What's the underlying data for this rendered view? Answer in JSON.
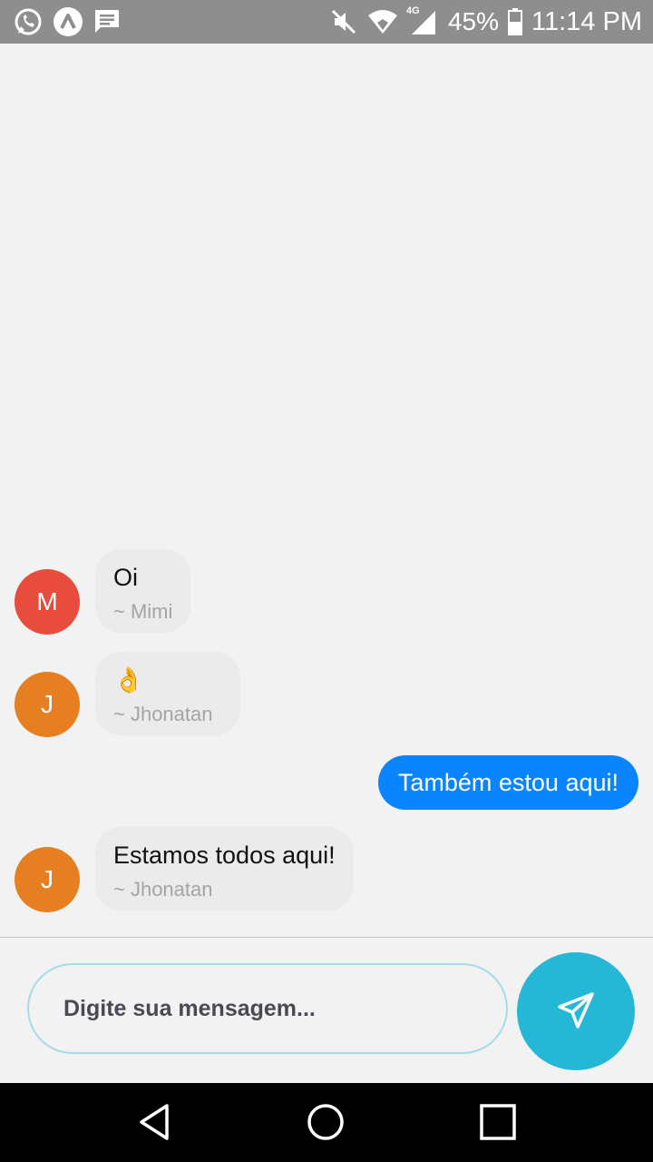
{
  "status_bar": {
    "battery": "45%",
    "time": "11:14 PM",
    "network": "4G",
    "icons_left": [
      "whatsapp-icon",
      "app-icon",
      "message-icon"
    ],
    "icons_right": [
      "mute-icon",
      "wifi-icon",
      "signal-icon",
      "battery-icon"
    ]
  },
  "messages": [
    {
      "type": "incoming",
      "avatar_letter": "M",
      "avatar_color": "#e74c3c",
      "text": "Oi",
      "author": "~ Mimi"
    },
    {
      "type": "incoming",
      "avatar_letter": "J",
      "avatar_color": "#e67e22",
      "text": "👌",
      "author": "~ Jhonatan"
    },
    {
      "type": "outgoing",
      "text": "Também estou aqui!",
      "color": "#0b84ff"
    },
    {
      "type": "incoming",
      "avatar_letter": "J",
      "avatar_color": "#e67e22",
      "text": "Estamos todos aqui!",
      "author": "~ Jhonatan"
    }
  ],
  "composer": {
    "placeholder": "Digite sua mensagem...",
    "send_icon": "send-icon",
    "send_color": "#25b8d6"
  },
  "nav_bar": {
    "icons": [
      "back-icon",
      "home-icon",
      "recents-icon"
    ]
  }
}
